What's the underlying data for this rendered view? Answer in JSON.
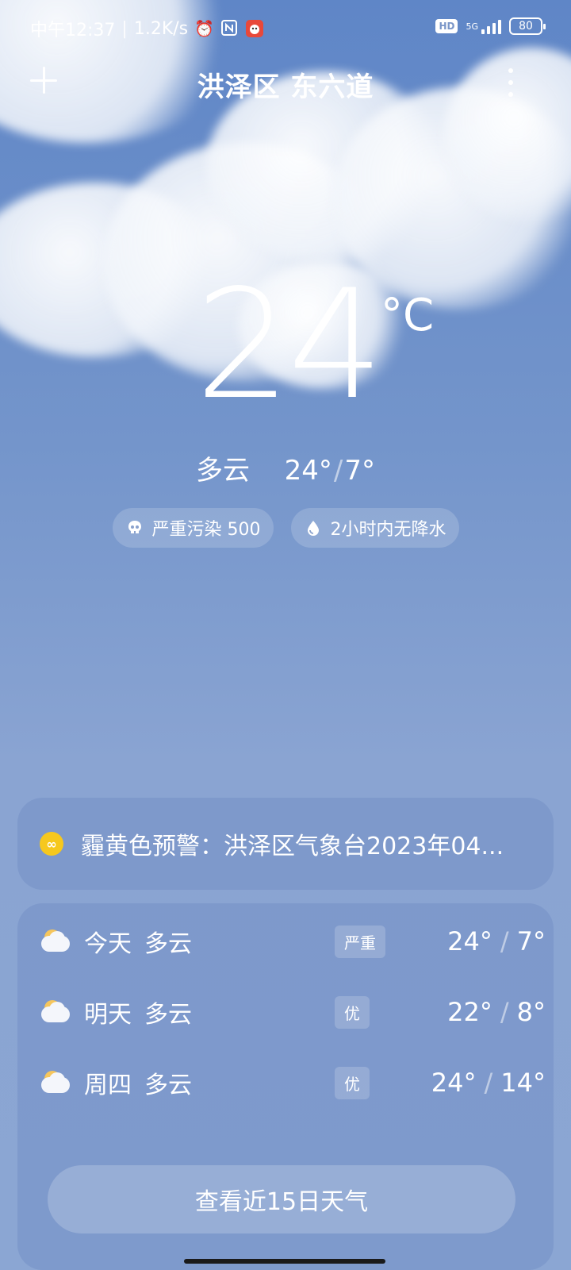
{
  "status_bar": {
    "time": "中午12:37",
    "network_speed": "1.2K/s",
    "icons": [
      "alarm-icon",
      "nfc-icon",
      "app-notification-icon"
    ],
    "hd_label": "HD",
    "network_label": "5G",
    "battery": "80"
  },
  "header": {
    "location": "洪泽区 东六道",
    "add_icon": "plus-icon",
    "more_icon": "more-vertical-icon"
  },
  "current": {
    "temperature": "24",
    "unit": "°C",
    "condition": "多云",
    "high": "24°",
    "low": "7°",
    "slash": "/"
  },
  "pills": [
    {
      "icon": "skull-icon",
      "label": "严重污染 500"
    },
    {
      "icon": "droplet-icon",
      "label": "2小时内无降水"
    }
  ],
  "alert": {
    "icon": "haze-warning-icon",
    "color": "#f6c81e",
    "text": "霾黄色预警：洪泽区气象台2023年04..."
  },
  "forecast": {
    "rows": [
      {
        "day": "今天",
        "condition": "多云",
        "aqi": "严重",
        "high": "24°",
        "low": "7°",
        "icon": "partly-cloudy-icon"
      },
      {
        "day": "明天",
        "condition": "多云",
        "aqi": "优",
        "high": "22°",
        "low": "8°",
        "icon": "partly-cloudy-icon"
      },
      {
        "day": "周四",
        "condition": "多云",
        "aqi": "优",
        "high": "24°",
        "low": "14°",
        "icon": "partly-cloudy-icon"
      }
    ],
    "slash": "/",
    "view_15_days": "查看近15日天气"
  }
}
